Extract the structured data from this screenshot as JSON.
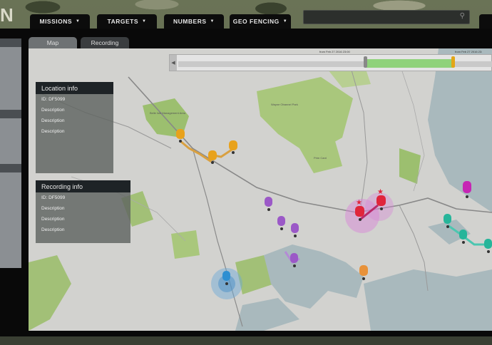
{
  "app": {
    "logo": "N"
  },
  "nav": [
    {
      "label": "MISSIONS"
    },
    {
      "label": "TARGETS"
    },
    {
      "label": "NUMBERS"
    },
    {
      "label": "GEO FENCING"
    }
  ],
  "search": {
    "placeholder": "",
    "icon": "search-icon"
  },
  "tabs": [
    {
      "label": "Map",
      "active": true
    },
    {
      "label": "Recording",
      "active": false
    }
  ],
  "timeline": {
    "start_label": "from Feb 27 2016 23:00",
    "end_label": "from Feb 27 2016 23:",
    "prev_icon": "chevron-left-icon",
    "colors": {
      "range": "#8fd27a",
      "end_handle": "#e3a617"
    }
  },
  "location_info": {
    "title": "Location info",
    "rows": [
      "ID: DF5099",
      "Description",
      "Description",
      "Description"
    ]
  },
  "recording_info": {
    "title": "Recording info",
    "rows": [
      "ID: DF5099",
      "Description",
      "Description",
      "Description"
    ]
  },
  "map": {
    "labels": [
      "Wayne Obannel Park",
      "Belle Isle Management Area",
      "Prim Cant"
    ],
    "marker_colors": {
      "yellow": "#e8a21c",
      "purple": "#9b59c7",
      "red": "#e0253b",
      "blue": "#2e8fd1",
      "orange": "#e8923a",
      "teal": "#26b59a",
      "magenta": "#c626b4"
    }
  }
}
